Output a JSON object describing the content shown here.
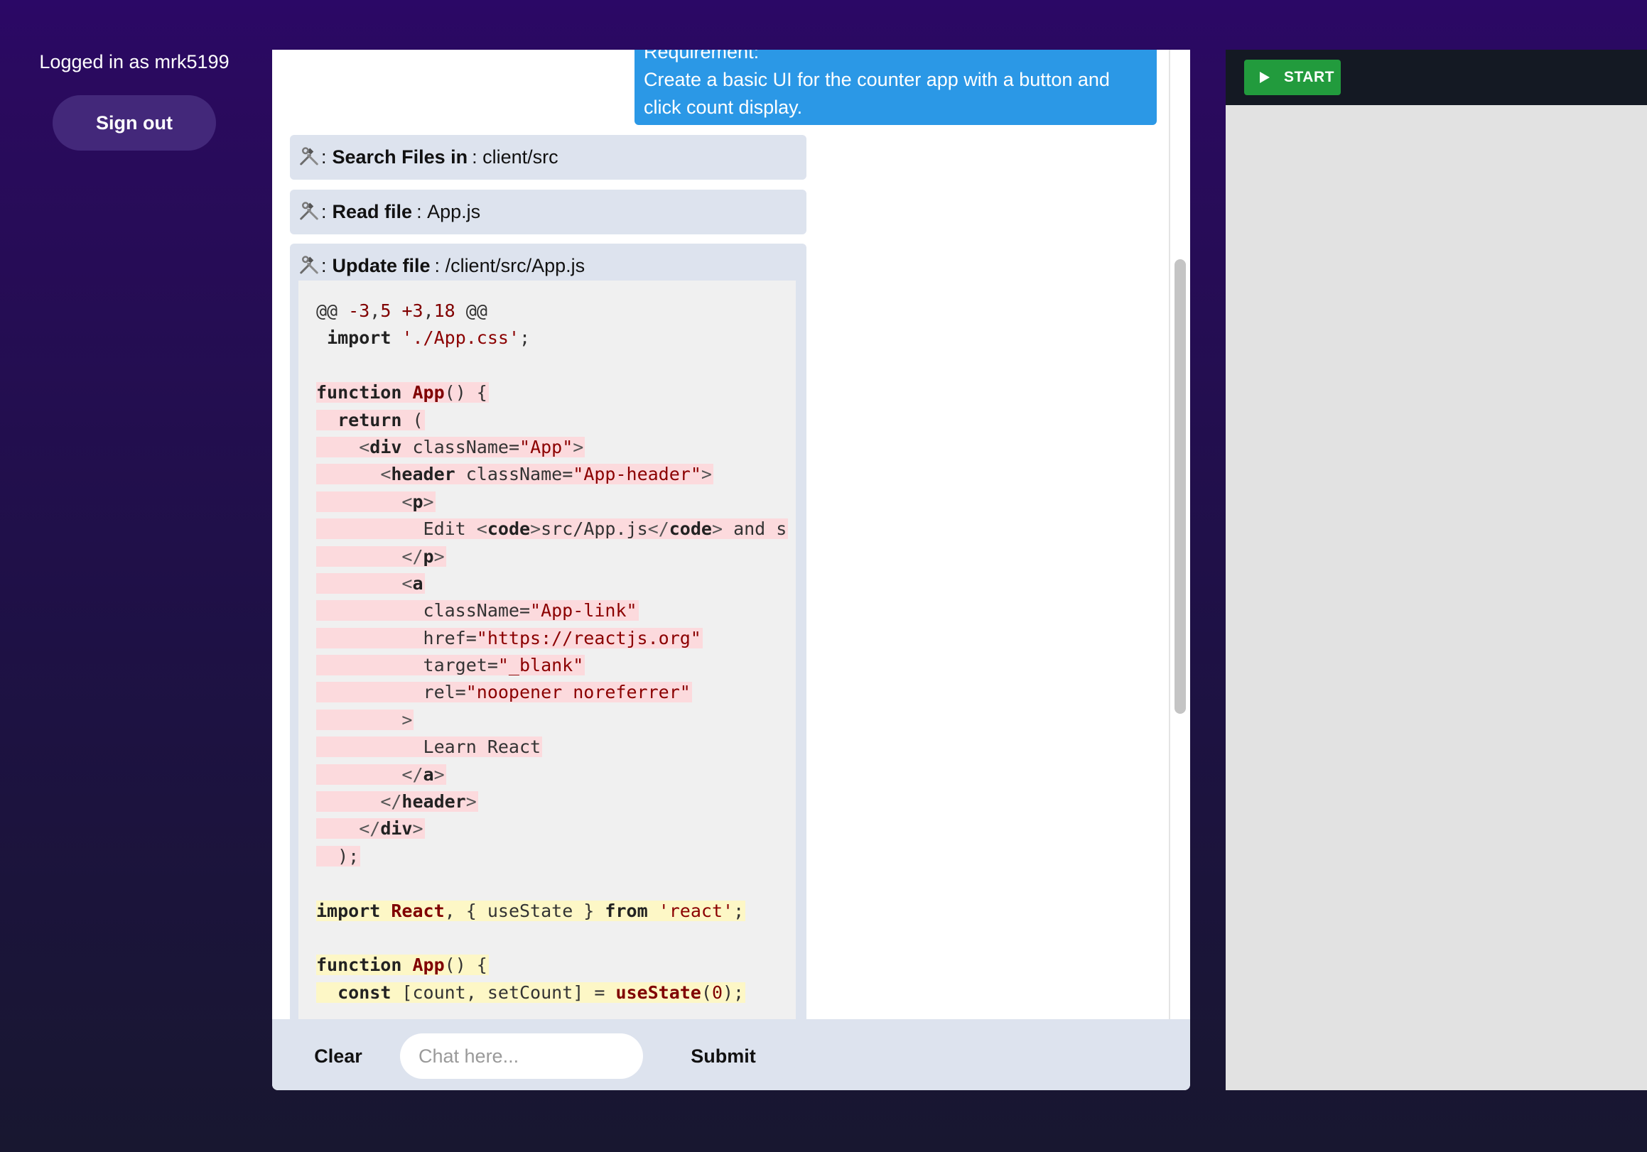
{
  "sidebar": {
    "logged_in_text": "Logged in as mrk5199",
    "sign_out_label": "Sign out"
  },
  "chat": {
    "user_message": {
      "line0": "Requirement:",
      "line1": "Create a basic UI for the counter app with a button and",
      "line2": "click count display."
    },
    "tool_calls": [
      {
        "icon": "hammer-wrench-icon",
        "action": "Search Files in",
        "target": "client/src"
      },
      {
        "icon": "hammer-wrench-icon",
        "action": "Read file",
        "target": "App.js"
      },
      {
        "icon": "hammer-wrench-icon",
        "action": "Update file",
        "target": "/client/src/App.js"
      }
    ],
    "diff": {
      "hunk_header": "@@ -3,5 +3,18 @@",
      "lines": [
        " import './App.css';",
        "",
        "function App() {",
        "  return (",
        "    <div className=\"App\">",
        "      <header className=\"App-header\">",
        "        <p>",
        "          Edit <code>src/App.js</code> and s",
        "        </p>",
        "        <a",
        "          className=\"App-link\"",
        "          href=\"https://reactjs.org\"",
        "          target=\"_blank\"",
        "          rel=\"noopener noreferrer\"",
        "        >",
        "          Learn React",
        "        </a>",
        "      </header>",
        "    </div>",
        "  );",
        "",
        "import React, { useState } from 'react';",
        "",
        "function App() {",
        "  const [count, setCount] = useState(0);"
      ]
    },
    "input": {
      "clear_label": "Clear",
      "placeholder": "Chat here...",
      "value": "",
      "submit_label": "Submit"
    }
  },
  "preview": {
    "start_label": "START",
    "start_icon": "play-icon",
    "start_color": "#229b3d"
  },
  "colors": {
    "user_bubble": "#2b98e6",
    "tool_card": "#dde3ee",
    "diff_removed": "#fcdadd",
    "diff_added": "#fdf7c6"
  }
}
